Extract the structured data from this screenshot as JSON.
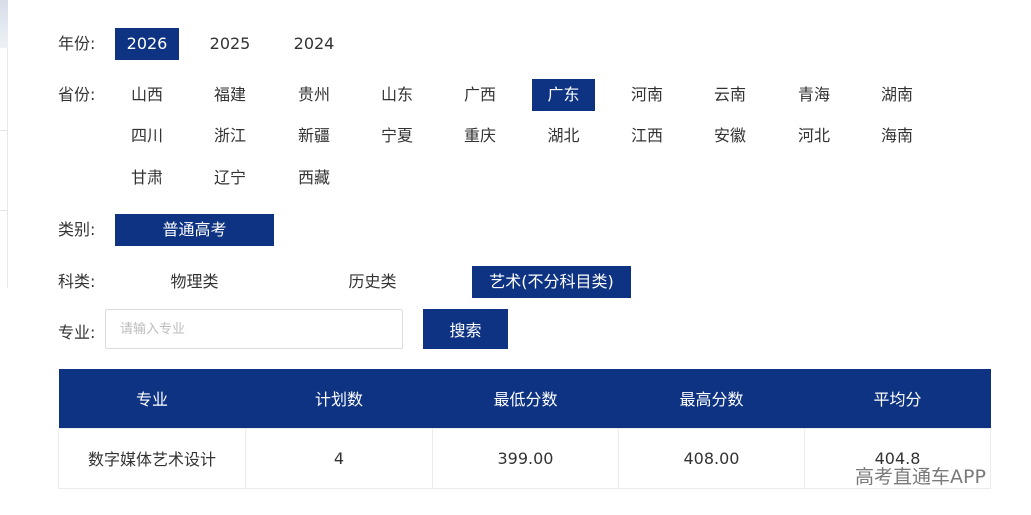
{
  "year": {
    "label": "年份:",
    "options": [
      "2026",
      "2025",
      "2024"
    ],
    "selected": "2026"
  },
  "province": {
    "label": "省份:",
    "options": [
      "山西",
      "福建",
      "贵州",
      "山东",
      "广西",
      "广东",
      "河南",
      "云南",
      "青海",
      "湖南",
      "四川",
      "浙江",
      "新疆",
      "宁夏",
      "重庆",
      "湖北",
      "江西",
      "安徽",
      "河北",
      "海南",
      "甘肃",
      "辽宁",
      "西藏"
    ],
    "selected": "广东"
  },
  "category": {
    "label": "类别:",
    "options": [
      "普通高考"
    ],
    "selected": "普通高考"
  },
  "subject_type": {
    "label": "科类:",
    "options": [
      "物理类",
      "历史类",
      "艺术(不分科目类)"
    ],
    "selected": "艺术(不分科目类)"
  },
  "major": {
    "label": "专业:",
    "placeholder": "请输入专业",
    "value": "",
    "search_label": "搜索"
  },
  "table": {
    "headers": [
      "专业",
      "计划数",
      "最低分数",
      "最高分数",
      "平均分"
    ],
    "rows": [
      [
        "数字媒体艺术设计",
        "4",
        "399.00",
        "408.00",
        "404.8"
      ]
    ]
  },
  "watermark": "高考直通车APP",
  "colors": {
    "accent": "#0e3383",
    "text": "#333333",
    "border": "#ececec"
  }
}
